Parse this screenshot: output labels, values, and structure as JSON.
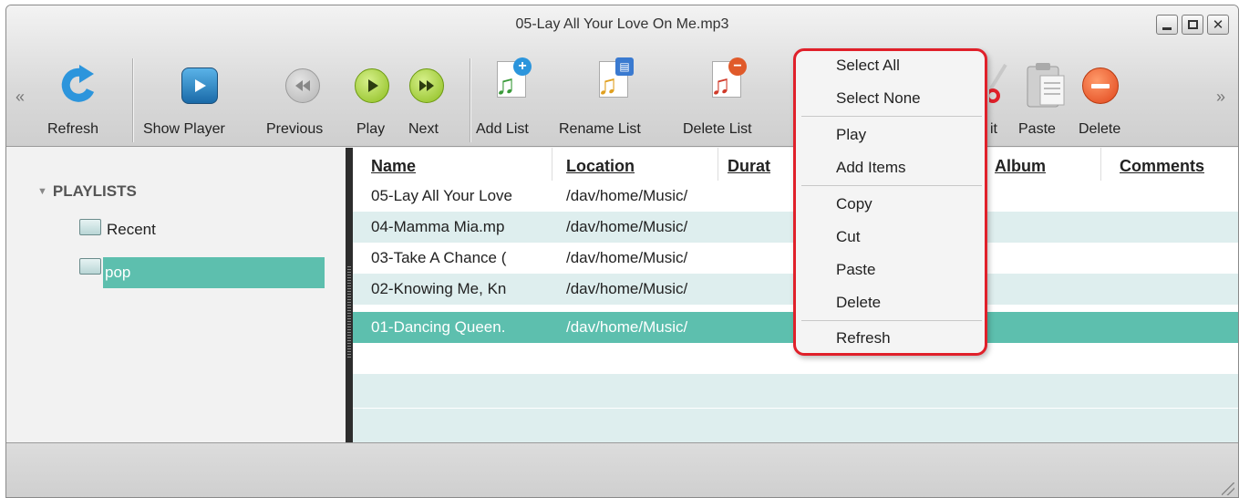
{
  "window": {
    "title": "05-Lay All Your Love On Me.mp3",
    "controls": {
      "minimize": "_",
      "maximize": "□",
      "close": "✕"
    }
  },
  "toolbar": {
    "scroll_left": "«",
    "scroll_right": "»",
    "buttons": {
      "refresh": "Refresh",
      "show_player": "Show Player",
      "previous": "Previous",
      "play": "Play",
      "next": "Next",
      "add_list": "Add List",
      "rename_list": "Rename List",
      "delete_list": "Delete List",
      "cut": "Cut",
      "paste": "Paste",
      "delete": "Delete"
    },
    "cut_label_visible": "it"
  },
  "sidebar": {
    "header": "PLAYLISTS",
    "items": [
      {
        "label": "Recent",
        "selected": false
      },
      {
        "label": "pop",
        "selected": true
      }
    ]
  },
  "table": {
    "columns": [
      "Name",
      "Location",
      "Durat",
      "Album",
      "Comments"
    ],
    "rows": [
      {
        "name": "05-Lay All Your Love",
        "location": "/dav/home/Music/"
      },
      {
        "name": "04-Mamma Mia.mp",
        "location": "/dav/home/Music/"
      },
      {
        "name": "03-Take A Chance (",
        "location": "/dav/home/Music/"
      },
      {
        "name": "02-Knowing Me, Kn",
        "location": "/dav/home/Music/"
      },
      {
        "name": "01-Dancing Queen.",
        "location": "/dav/home/Music/"
      }
    ],
    "selected_row_index": 4
  },
  "context_menu": {
    "items": [
      "Select All",
      "Select None",
      "Play",
      "Add Items",
      "Copy",
      "Cut",
      "Paste",
      "Delete",
      "Refresh"
    ]
  },
  "colors": {
    "selection": "#5dbfae",
    "alt_row": "#deeeee",
    "menu_highlight_border": "#e0202a"
  }
}
